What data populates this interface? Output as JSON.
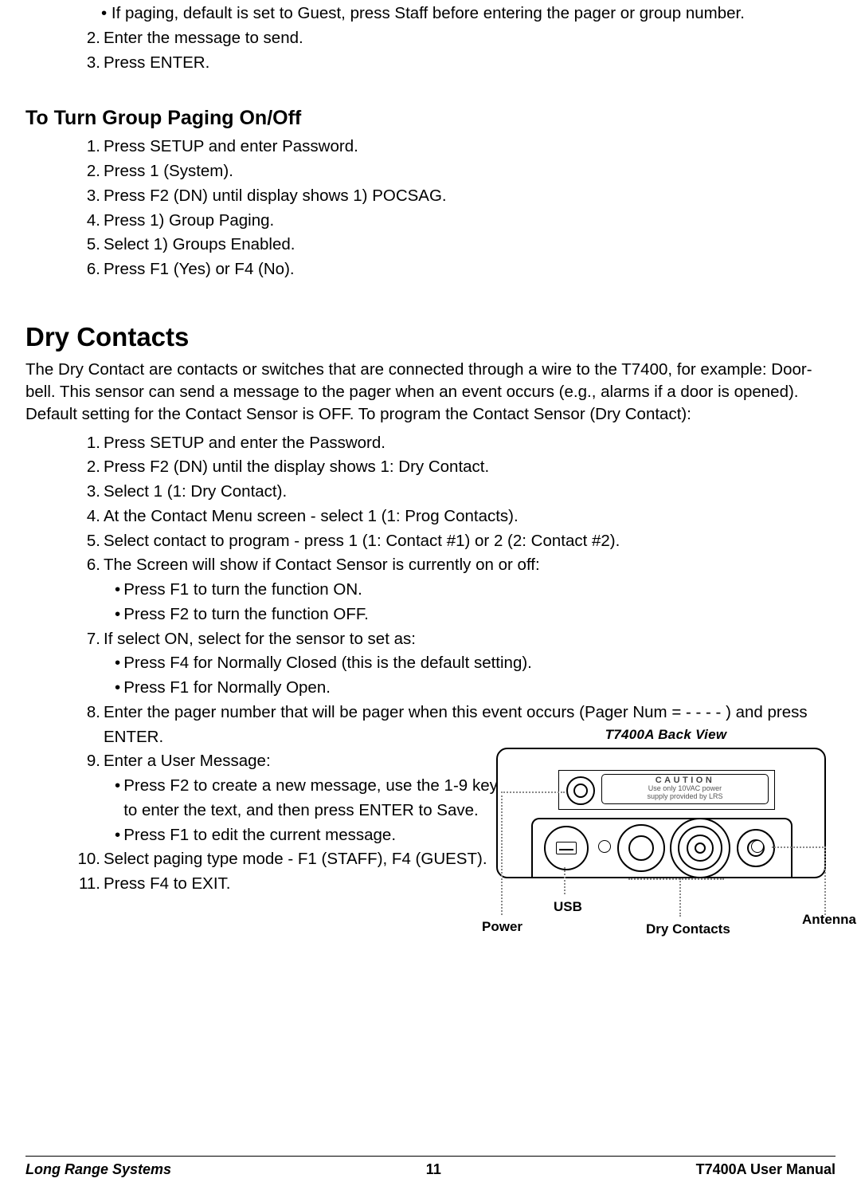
{
  "top_bullet": "If paging, default is set to Guest, press Staff before entering the pager or group number.",
  "top_steps": {
    "s2": "Enter the message to send.",
    "s3": "Press ENTER."
  },
  "group_heading": "To Turn Group Paging On/Off",
  "group_steps": {
    "s1": "Press SETUP and enter Password.",
    "s2": "Press 1 (System).",
    "s3": "Press F2 (DN) until display shows 1) POCSAG.",
    "s4": "Press 1) Group Paging.",
    "s5": "Select 1) Groups Enabled.",
    "s6": "Press F1 (Yes) or F4 (No)."
  },
  "dry_heading": "Dry Contacts",
  "dry_para": "The Dry Contact are contacts or switches that are connected through a wire to the T7400, for example: Door-bell. This sensor can send a message to the pager when an event occurs (e.g., alarms if a door is opened). Default setting for the Contact Sensor is OFF. To program the Contact Sensor (Dry Contact):",
  "dry_steps": {
    "s1": "Press SETUP and enter the Password.",
    "s2": "Press F2 (DN) until the display shows 1: Dry Contact.",
    "s3": "Select 1 (1: Dry Contact).",
    "s4": "At the Contact Menu screen - select 1 (1: Prog Contacts).",
    "s5": "Select contact to program - press 1 (1: Contact #1) or 2 (2: Contact #2).",
    "s6": "The Screen will show if Contact Sensor is currently on or off:",
    "s6a": "Press F1 to turn the function ON.",
    "s6b": "Press F2 to turn the function OFF.",
    "s7": "If select ON, select for the sensor to set as:",
    "s7a": "Press F4 for Normally Closed (this is the default setting).",
    "s7b": "Press F1 for Normally Open.",
    "s8": "Enter the pager number that will be pager when this event occurs (Pager Num = - - - - ) and press ENTER.",
    "s9": "Enter a User Message:",
    "s9a": "Press F2 to create a new message, use the 1-9 keys to enter the text, and then press ENTER to Save.",
    "s9b": "Press F1 to edit the current message.",
    "s10": "Select paging type mode - F1 (STAFF), F4 (GUEST).",
    "s11": "Press F4 to EXIT."
  },
  "figure": {
    "title": "T7400A Back View",
    "caution_title": "CAUTION",
    "caution_line1": "Use only 10VAC power",
    "caution_line2": "supply provided by LRS",
    "labels": {
      "power": "Power",
      "usb": "USB",
      "dry": "Dry Contacts",
      "antenna": "Antenna"
    }
  },
  "footer": {
    "left": "Long Range Systems",
    "center": "11",
    "right": "T7400A User Manual"
  }
}
